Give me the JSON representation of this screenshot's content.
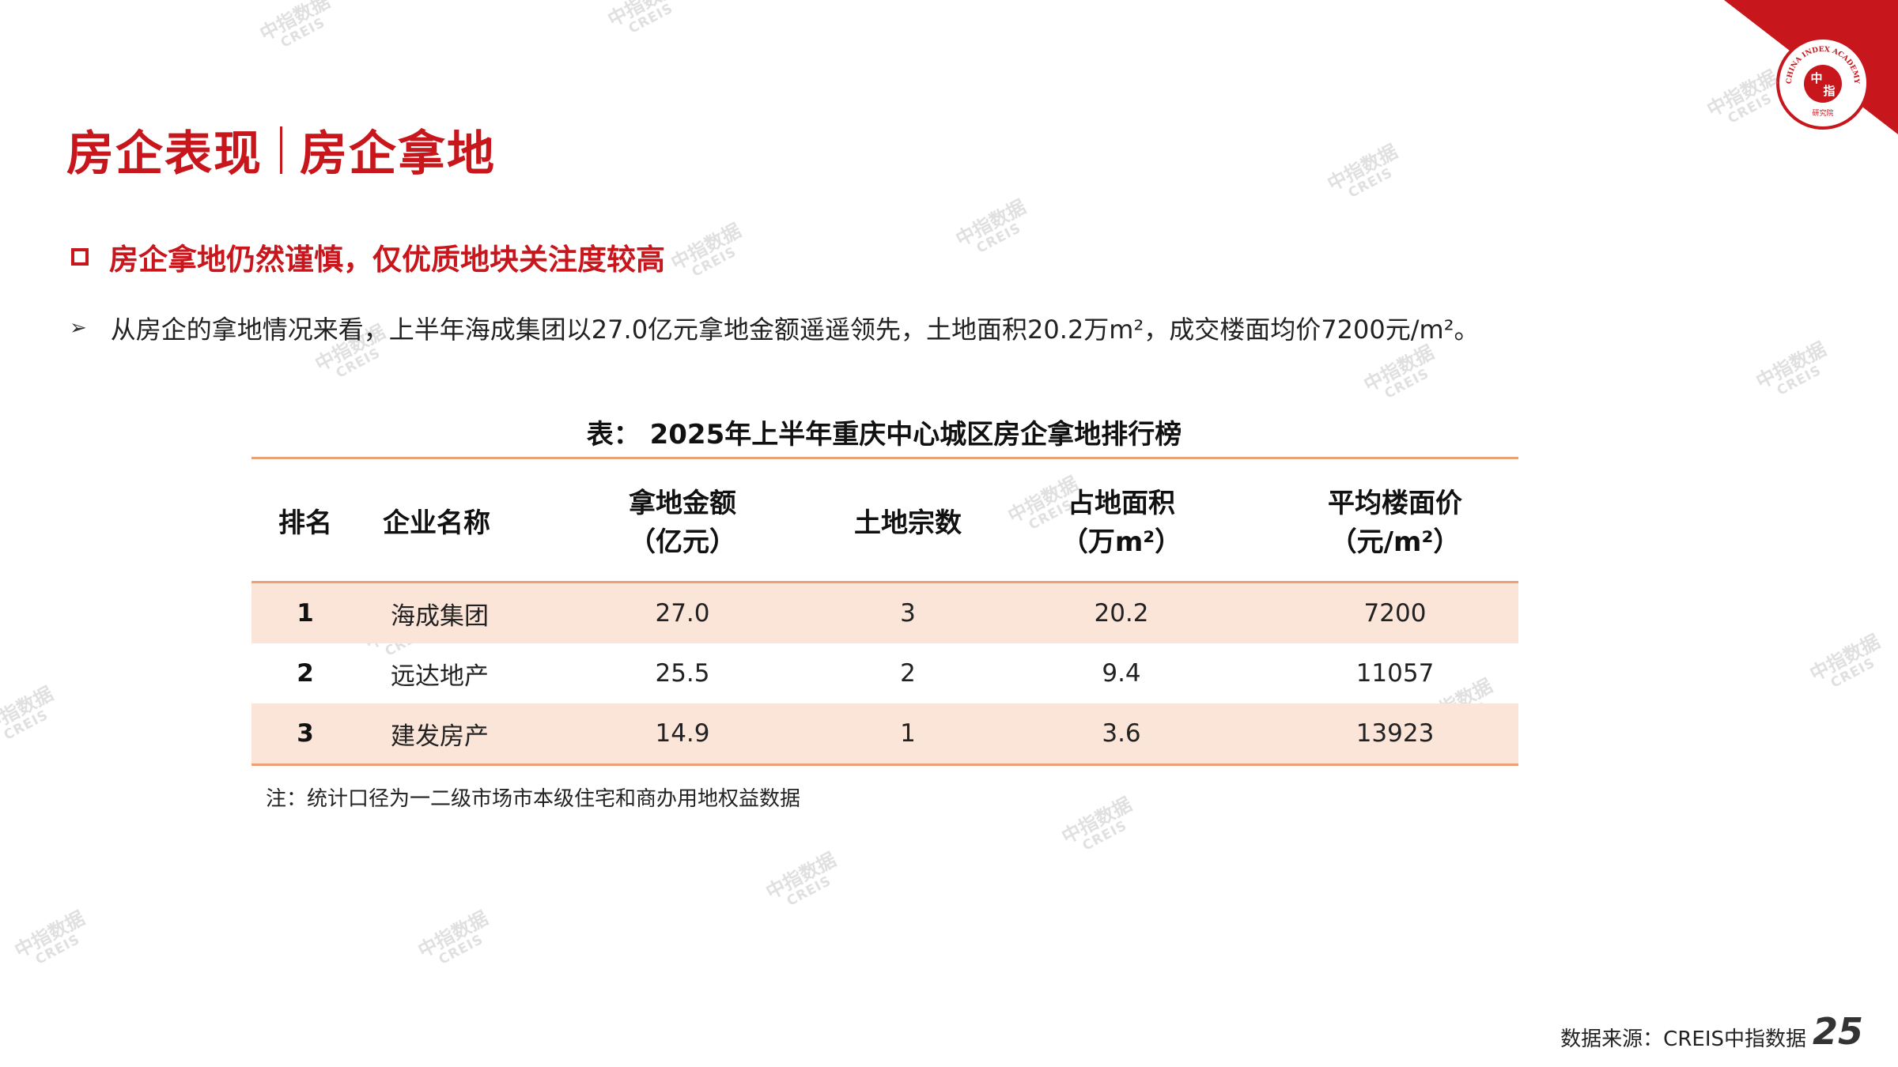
{
  "header": {
    "title_left": "房企表现",
    "title_right": "房企拿地",
    "logo_text_top": "CHINA INDEX ACADEMY",
    "logo_text_center_1": "中",
    "logo_text_center_2": "指",
    "logo_text_bottom": "研究院"
  },
  "section": {
    "subtitle": "房企拿地仍然谨慎，仅优质地块关注度较高",
    "bullet": "从房企的拿地情况来看，上半年海成集团以27.0亿元拿地金额遥遥领先，土地面积20.2万m²，成交楼面均价7200元/m²。"
  },
  "table": {
    "title": "表： 2025年上半年重庆中心城区房企拿地排行榜",
    "headers": {
      "rank": "排名",
      "company": "企业名称",
      "amount_1": "拿地金额",
      "amount_2": "（亿元）",
      "parcels": "土地宗数",
      "area_1": "占地面积",
      "area_2": "（万m²）",
      "price_1": "平均楼面价",
      "price_2": "（元/m²）"
    },
    "rows": [
      {
        "rank": "1",
        "company": "海成集团",
        "amount": "27.0",
        "parcels": "3",
        "area": "20.2",
        "price": "7200"
      },
      {
        "rank": "2",
        "company": "远达地产",
        "amount": "25.5",
        "parcels": "2",
        "area": "9.4",
        "price": "11057"
      },
      {
        "rank": "3",
        "company": "建发房产",
        "amount": "14.9",
        "parcels": "1",
        "area": "3.6",
        "price": "13923"
      }
    ],
    "note": "注：统计口径为一二级市场市本级住宅和商办用地权益数据"
  },
  "footer": {
    "source": "数据来源：CREIS中指数据",
    "page": "25"
  },
  "watermark": {
    "cn": "中指数据",
    "en": "CREIS"
  },
  "colors": {
    "accent": "#c8161d",
    "table_line": "#e9a175",
    "row_shade": "#fbe4d8"
  }
}
